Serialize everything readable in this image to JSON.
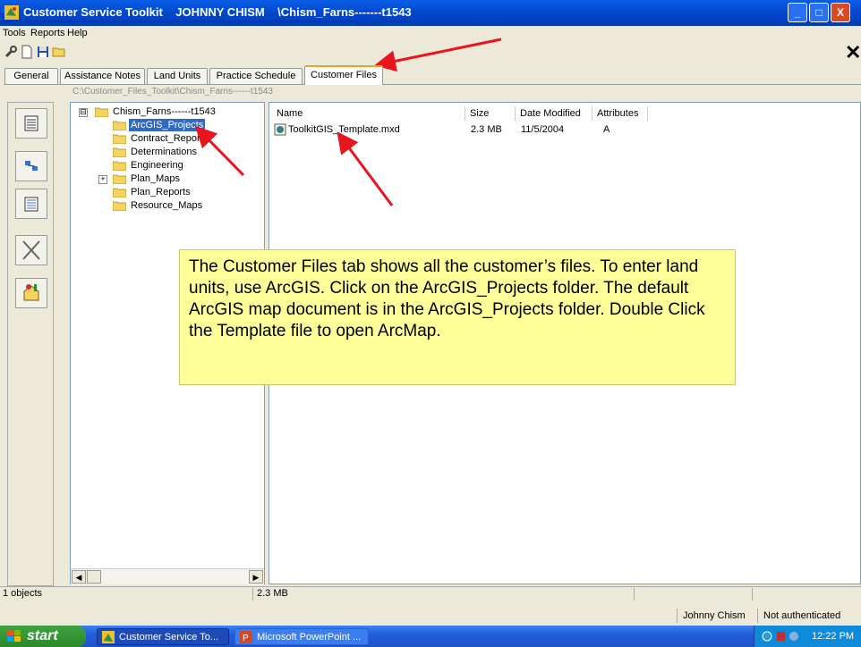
{
  "window": {
    "title": "Customer Service Toolkit    JOHNNY CHISM    \\Chism_Farns-------t1543",
    "controls": {
      "minimize": "_",
      "maximize": "□",
      "close": "X"
    }
  },
  "menubar": {
    "items": [
      "Tools",
      "Reports",
      "Help"
    ]
  },
  "toolbar": {
    "close_glyph": "✕"
  },
  "tabs": [
    "General",
    "Assistance Notes",
    "Land Units",
    "Practice Schedule",
    "Customer Files"
  ],
  "active_tab": "Customer Files",
  "path": "C:\\Customer_Files_Toolkit\\Chism_Farns------t1543",
  "tree": {
    "root": "Chism_Farns------t1543",
    "root_expander": "⊟",
    "children": [
      "ArcGIS_Projects",
      "Contract_Reports",
      "Determinations",
      "Engineering",
      "Plan_Maps",
      "Plan_Reports",
      "Resource_Maps"
    ],
    "selected": "ArcGIS_Projects",
    "expander": "+"
  },
  "file_list": {
    "columns": [
      "Name",
      "Size",
      "Date Modified",
      "Attributes"
    ],
    "rows": [
      {
        "name": "ToolkitGIS_Template.mxd",
        "size": "2.3 MB",
        "date": "11/5/2004",
        "attr": "A"
      }
    ]
  },
  "callout": {
    "text": "The Customer Files tab shows all the customer’s files. To enter land units, use ArcGIS. Click on the ArcGIS_Projects folder. The default ArcGIS map document is in the ArcGIS_Projects folder. Double Click the Template file to open ArcMap."
  },
  "status": {
    "objects": "1 objects",
    "size": "2.3 MB",
    "user": "Johnny Chism",
    "auth": "Not authenticated"
  },
  "taskbar": {
    "start": "start",
    "items": [
      "Customer Service To...",
      "Microsoft PowerPoint ..."
    ],
    "clock": "12:22 PM"
  },
  "colors": {
    "accent": "#316ac5",
    "callout": "#ffff99",
    "arrow": "#e8141e"
  }
}
